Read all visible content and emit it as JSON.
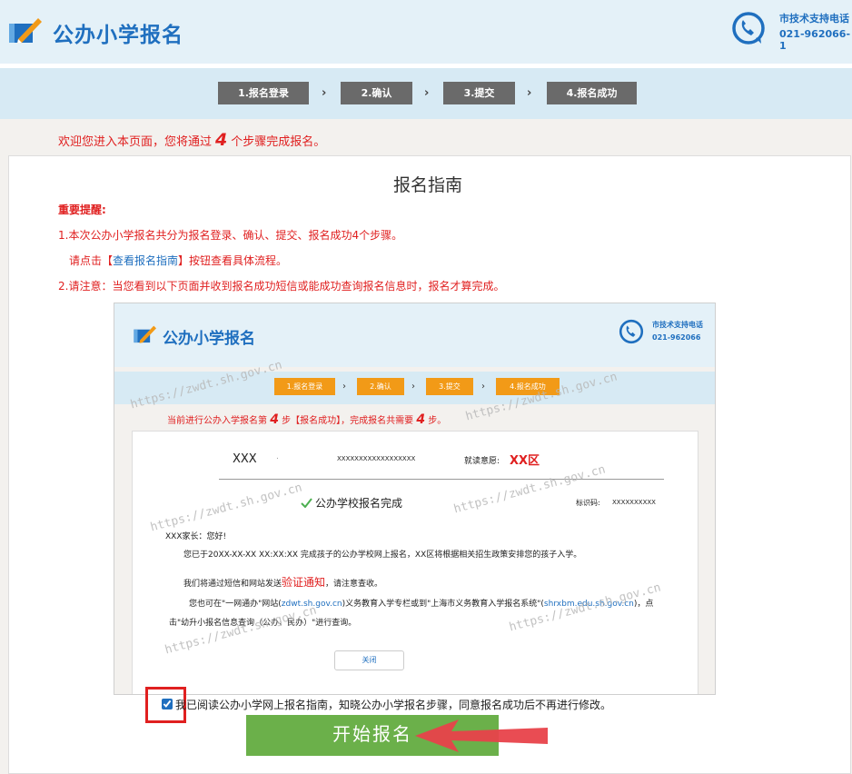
{
  "header": {
    "title": "公办小学报名",
    "support_label": "市技术支持电话",
    "support_phone": "021-962066-1"
  },
  "steps": [
    "1.报名登录",
    "2.确认",
    "3.提交",
    "4.报名成功"
  ],
  "welcome": {
    "before": "欢迎您进入本页面，您将通过",
    "count": "4",
    "after": "个步骤完成报名。"
  },
  "guide": {
    "title": "报名指南",
    "important": "重要提醒:",
    "line1": "1.本次公办小学报名共分为报名登录、确认、提交、报名成功4个步骤。",
    "line2_before": "请点击【",
    "line2_link": "查看报名指南",
    "line2_after": "】按钮查看具体流程。",
    "line3": "2.请注意：当您看到以下页面并收到报名成功短信或能成功查询报名信息时，报名才算完成。"
  },
  "sample": {
    "title": "公办小学报名",
    "support_label": "市技术支持电话",
    "support_phone": "021-962066",
    "steps": [
      "1.报名登录",
      "2.确认",
      "3.提交",
      "4.报名成功"
    ],
    "progress_before": "当前进行公办入学报名第",
    "progress_step": "4",
    "progress_mid": "步【报名成功】，完成报名共需要",
    "progress_total": "4",
    "progress_after": "步。",
    "name": "XXX",
    "dot": ".",
    "id_number": "XXXXXXXXXXXXXXXXXX",
    "district_label": "就读意愿:",
    "district_value": "XX区",
    "status": "公办学校报名完成",
    "code_label": "标识码:",
    "code_value": "XXXXXXXXXX",
    "greeting": "XXX家长：您好!",
    "para1": "您已于20XX-XX-XX XX:XX:XX 完成孩子的公办学校网上报名，XX区将根据相关招生政策安排您的孩子入学。",
    "para2_before": "我们将通过短信和网站发送",
    "para2_highlight": "验证通知",
    "para2_after": "，请注意查收。",
    "para3_a": "您也可在\"一网通办\"网站(",
    "para3_link1": "zdwt.sh.gov.cn",
    "para3_b": ")义务教育入学专栏或到\"上海市义务教育入学报名系统\"(",
    "para3_link2": "shrxbm.edu.sh.gov.cn",
    "para3_c": ")，点",
    "para4": "击\"幼升小报名信息查询（公办、民办）\"进行查询。",
    "close_label": "关闭",
    "watermark": "https://zwdt.sh.gov.cn"
  },
  "agreement": "我已阅读公办小学网上报名指南，知晓公办小学报名步骤，同意报名成功后不再进行修改。",
  "start_button": "开始报名",
  "colors": {
    "brand": "#1f6fbf",
    "alert": "#e02020",
    "start": "#6bb04a",
    "sample_step": "#f29a17"
  }
}
